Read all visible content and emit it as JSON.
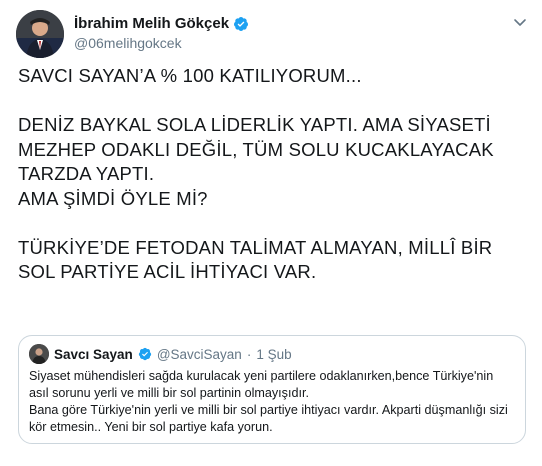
{
  "author": {
    "name": "İbrahim Melih Gökçek",
    "handle": "@06melihgokcek"
  },
  "tweet": {
    "text": "SAVCI SAYAN’A % 100 KATILIYORUM...\n\nDENİZ BAYKAL SOLA LİDERLİK YAPTI. AMA SİYASETİ MEZHEP ODAKLI DEĞİL, TÜM SOLU KUCAKLAYACAK TARZDA YAPTI.\nAMA ŞİMDİ ÖYLE Mİ?\n\nTÜRKİYE’DE FETODAN TALİMAT ALMAYAN, MİLLÎ BİR SOL PARTİYE ACİL İHTİYACI VAR."
  },
  "quoted_tweet": {
    "name": "Savcı Sayan",
    "handle": "@SavciSayan",
    "separator": "·",
    "date": "1 Şub",
    "text": "Siyaset mühendisleri sağda kurulacak yeni partilere odaklanırken,bence Türkiye'nin asıl sorunu yerli ve milli bir sol partinin olmayışıdır.\nBana göre Türkiye'nin yerli ve milli bir sol partiye ihtiyacı vardır. Akparti düşmanlığı sizi kör etmesin.. Yeni bir sol partiye kafa yorun."
  },
  "colors": {
    "verified": "#1da1f2",
    "secondary_text": "#657786",
    "border": "#ccd6dd"
  },
  "icons": {
    "verified": "verified-badge-icon",
    "menu": "chevron-down-icon"
  }
}
